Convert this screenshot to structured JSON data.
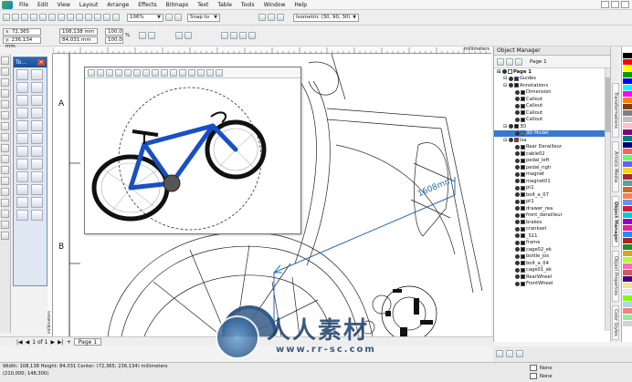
{
  "menu": {
    "items": [
      "File",
      "Edit",
      "View",
      "Layout",
      "Arrange",
      "Effects",
      "Bitmaps",
      "Text",
      "Table",
      "Tools",
      "Window",
      "Help"
    ]
  },
  "standard_toolbar": {
    "zoom": "106%",
    "snap": "Snap to",
    "view_preset": "Isometric (30, 90, 30)"
  },
  "property_bar": {
    "x": "x: 72,365 mm",
    "y": "y: 236,134 mm",
    "w": "108,138 mm",
    "h": "84,031 mm",
    "scale_w": "100,0",
    "scale_h": "100,0",
    "pct": "%"
  },
  "ruler": {
    "unit": "millimeters"
  },
  "docker": {
    "title": "To..."
  },
  "canvas": {
    "label_a": "A",
    "label_b": "B",
    "dimension": "1608mm"
  },
  "object_manager": {
    "title": "Object Manager",
    "page_label": "Page 1",
    "rows": [
      {
        "label": "Page 1",
        "indent": 0,
        "bold": true,
        "color": "#ffffff"
      },
      {
        "label": "Guides",
        "indent": 1,
        "color": "#1b1bd0"
      },
      {
        "label": "Annotations",
        "indent": 1,
        "color": "#111111"
      },
      {
        "label": "Dimension",
        "indent": 2,
        "color": "#111111"
      },
      {
        "label": "Callout",
        "indent": 2,
        "color": "#111111"
      },
      {
        "label": "Callout",
        "indent": 2,
        "color": "#111111"
      },
      {
        "label": "Callout",
        "indent": 2,
        "color": "#111111"
      },
      {
        "label": "Callout",
        "indent": 2,
        "color": "#111111"
      },
      {
        "label": "3D",
        "indent": 1,
        "color": "#111111"
      },
      {
        "label": "3D Model",
        "indent": 2,
        "color": "#3a78d0",
        "selected": true
      },
      {
        "label": "Isa",
        "indent": 1,
        "color": "#d01b1b"
      },
      {
        "label": "Rear Derailleur",
        "indent": 2,
        "color": "#111111"
      },
      {
        "label": "cable02",
        "indent": 2,
        "color": "#111111"
      },
      {
        "label": "pedal_left",
        "indent": 2,
        "color": "#111111"
      },
      {
        "label": "pedal_righ",
        "indent": 2,
        "color": "#111111"
      },
      {
        "label": "magnet",
        "indent": 2,
        "color": "#111111"
      },
      {
        "label": "magnet01",
        "indent": 2,
        "color": "#111111"
      },
      {
        "label": "pt1",
        "indent": 2,
        "color": "#111111"
      },
      {
        "label": "bolt_a_07",
        "indent": 2,
        "color": "#111111"
      },
      {
        "label": "pt1",
        "indent": 2,
        "color": "#111111"
      },
      {
        "label": "drawer_rea",
        "indent": 2,
        "color": "#111111"
      },
      {
        "label": "front_derailleur",
        "indent": 2,
        "color": "#111111"
      },
      {
        "label": "brakes",
        "indent": 2,
        "color": "#111111"
      },
      {
        "label": "crankset",
        "indent": 2,
        "color": "#111111"
      },
      {
        "label": "_S11",
        "indent": 2,
        "color": "#111111"
      },
      {
        "label": "frame",
        "indent": 2,
        "color": "#111111"
      },
      {
        "label": "cage02_ek",
        "indent": 2,
        "color": "#111111"
      },
      {
        "label": "bottle_jos",
        "indent": 2,
        "color": "#111111"
      },
      {
        "label": "bolt_a_04",
        "indent": 2,
        "color": "#111111"
      },
      {
        "label": "cage01_ek",
        "indent": 2,
        "color": "#111111"
      },
      {
        "label": "RearWheel",
        "indent": 2,
        "color": "#111111"
      },
      {
        "label": "FrontWheel",
        "indent": 2,
        "color": "#111111"
      }
    ]
  },
  "right_tabs": [
    "Transformations",
    "Artistic Media",
    "Object Manager",
    "Object Properties",
    "Color Styles"
  ],
  "palette": [
    "#ffffff",
    "#000000",
    "#ff0000",
    "#ffff00",
    "#00a000",
    "#0000ff",
    "#00ffff",
    "#ff00ff",
    "#ff8000",
    "#804000",
    "#808080",
    "#c0c0c0",
    "#ffc0cb",
    "#800080",
    "#008080",
    "#000080",
    "#ff6060",
    "#60ff60",
    "#6060ff",
    "#ffd700",
    "#a52a2a",
    "#5f9ea0",
    "#d2691e",
    "#ff7f50",
    "#6495ed",
    "#dc143c",
    "#00ced1",
    "#9400d3",
    "#ff1493",
    "#1e90ff",
    "#b22222",
    "#228b22",
    "#daa520",
    "#adff2f",
    "#ff69b4",
    "#cd5c5c",
    "#4b0082",
    "#f0e68c",
    "#e6e6fa",
    "#7cfc00",
    "#add8e6",
    "#f08080",
    "#90ee90",
    "#d3d3d3"
  ],
  "page_nav": {
    "position": "1 of 1",
    "tab": "Page 1"
  },
  "status": {
    "line1": "Width: 108,138  Height: 84,031  Center: (72,365; 236,134)  millimeters",
    "line2": "(210,000; 148,300)",
    "fill_none": "None",
    "outline_none": "None"
  },
  "side_labels": {
    "ruler_left": "millimeters"
  },
  "watermark": {
    "cn": "人人素材",
    "url": "www.rr-sc.com"
  }
}
